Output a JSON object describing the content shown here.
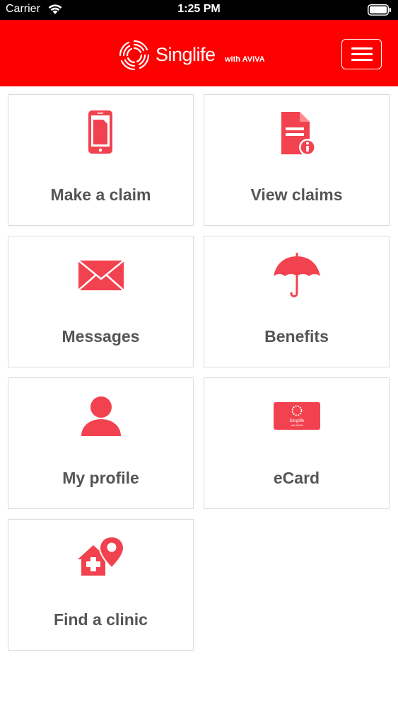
{
  "status_bar": {
    "carrier": "Carrier",
    "time": "1:25 PM"
  },
  "header": {
    "brand": "Singlife",
    "brand_sub": "with AVIVA",
    "accent_color": "#ff0000"
  },
  "tiles": [
    {
      "label": "Make a claim",
      "icon": "phone-document-icon"
    },
    {
      "label": "View claims",
      "icon": "document-info-icon"
    },
    {
      "label": "Messages",
      "icon": "envelope-icon"
    },
    {
      "label": "Benefits",
      "icon": "umbrella-icon"
    },
    {
      "label": "My profile",
      "icon": "person-icon"
    },
    {
      "label": "eCard",
      "icon": "card-icon"
    },
    {
      "label": "Find a clinic",
      "icon": "clinic-location-icon"
    }
  ],
  "colors": {
    "icon": "#f2424f",
    "tile_text": "#555555",
    "tile_border": "#dcdcdc"
  },
  "ecard": {
    "brand": "Singlife",
    "brand_sub": "with AVIVA"
  }
}
